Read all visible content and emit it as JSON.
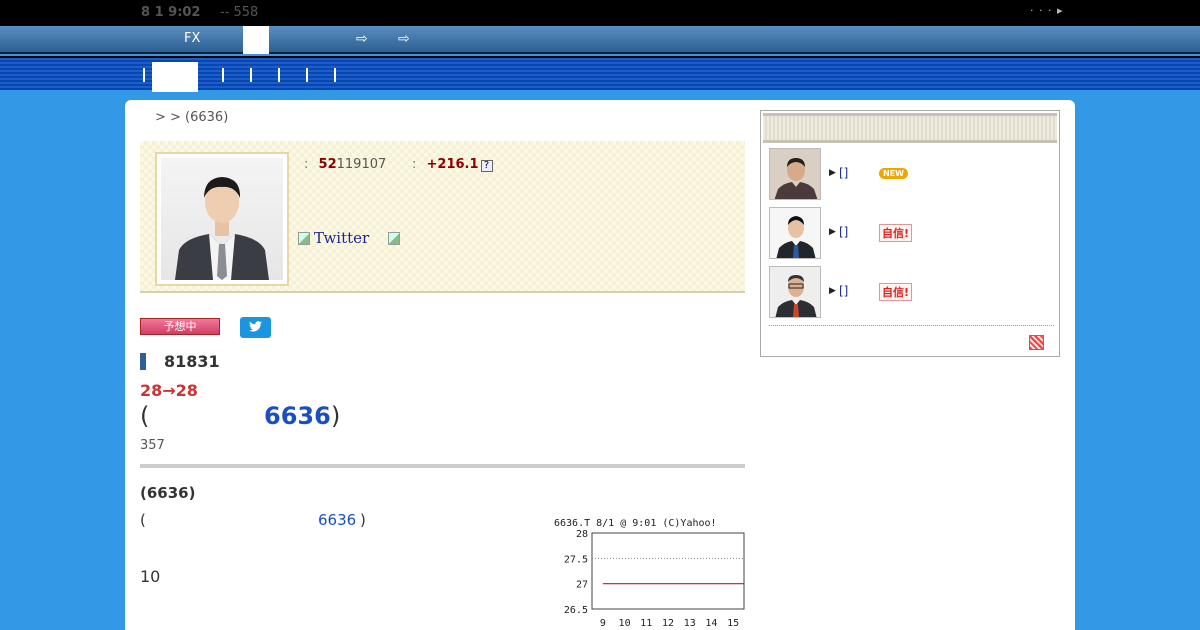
{
  "topbar": {
    "time": "8 1 9:02",
    "count": "-- 558",
    "right_mark": "· · · ▸"
  },
  "nav1": {
    "fx_label": "FX",
    "icons": [
      "logout-icon",
      "logout-icon"
    ]
  },
  "nav2": {
    "separators": 6
  },
  "breadcrumb": {
    "text": ">  > (6636)"
  },
  "profile": {
    "stat1_label": ":",
    "stat1_value": "52",
    "stat1_rest": "119107",
    "stat2_label": ":",
    "stat2_value": "+216.1",
    "help_glyph": "?",
    "twitter_label": "Twitter"
  },
  "main": {
    "predicting_badge": "予想中",
    "number_heading": "81831",
    "price_change": "28→28",
    "code_open": "(",
    "code": "6636",
    "code_close": ")",
    "small_number": "357",
    "section_title": "(6636)",
    "section_code_open": "(",
    "section_code": "6636",
    "section_code_close": ")",
    "ten": "10"
  },
  "chart_data": {
    "type": "line",
    "title": "6636.T      8/1 @ 9:01 (C)Yahoo!",
    "x_ticks": [
      "9",
      "10",
      "11",
      "12",
      "13",
      "14",
      "15"
    ],
    "y_ticks": [
      "28",
      "27.5",
      "27",
      "26.5"
    ],
    "ylim": [
      26.5,
      28
    ],
    "series": [
      {
        "x": [
          9,
          15.5
        ],
        "values": [
          27,
          27
        ]
      }
    ],
    "grid": "dotted horizontal at 27.5",
    "line_color": "#b02020"
  },
  "sidebar": {
    "items": [
      {
        "name": "[]",
        "badge": "NEW",
        "badge_type": "new"
      },
      {
        "name": "[]",
        "badge": "自信!",
        "badge_type": "confident"
      },
      {
        "name": "[]",
        "badge": "自信!",
        "badge_type": "confident"
      }
    ]
  }
}
